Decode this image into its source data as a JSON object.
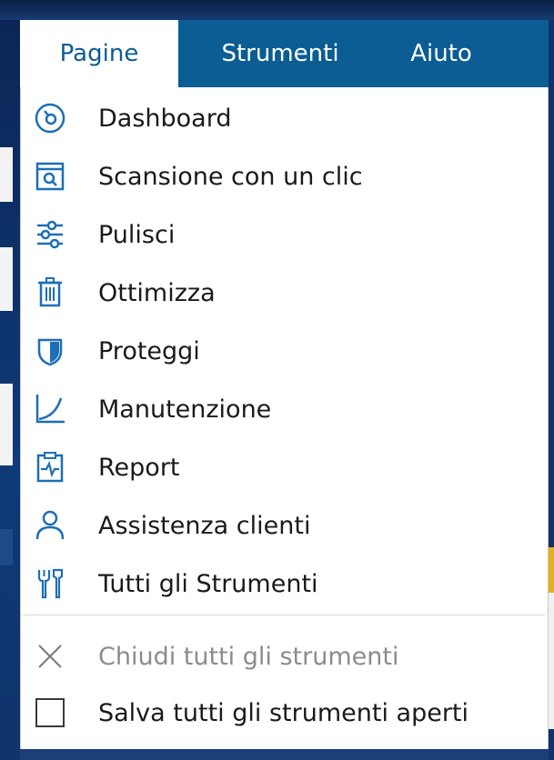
{
  "menubar": {
    "items": [
      {
        "label": "Pagine"
      },
      {
        "label": "Strumenti"
      },
      {
        "label": "Aiuto"
      }
    ]
  },
  "dropdown": {
    "items": [
      {
        "label": "Dashboard",
        "icon": "dashboard-icon"
      },
      {
        "label": "Scansione con un clic",
        "icon": "one-click-scan-icon"
      },
      {
        "label": "Pulisci",
        "icon": "sliders-icon"
      },
      {
        "label": "Ottimizza",
        "icon": "trash-icon"
      },
      {
        "label": "Proteggi",
        "icon": "shield-icon"
      },
      {
        "label": "Manutenzione",
        "icon": "chart-curve-icon"
      },
      {
        "label": "Report",
        "icon": "clipboard-pulse-icon"
      },
      {
        "label": "Assistenza clienti",
        "icon": "person-icon"
      },
      {
        "label": "Tutti gli Strumenti",
        "icon": "tools-icon"
      }
    ],
    "actions": [
      {
        "label": "Chiudi tutti gli strumenti",
        "icon": "close-icon",
        "disabled": true
      },
      {
        "label": "Salva tutti gli strumenti aperti",
        "icon": "checkbox-icon",
        "disabled": false
      }
    ]
  },
  "colors": {
    "menubar": "#0b5d93",
    "accent": "#1c6fb7",
    "text": "#1a1a1a",
    "disabled_text": "#8c8c8c"
  }
}
